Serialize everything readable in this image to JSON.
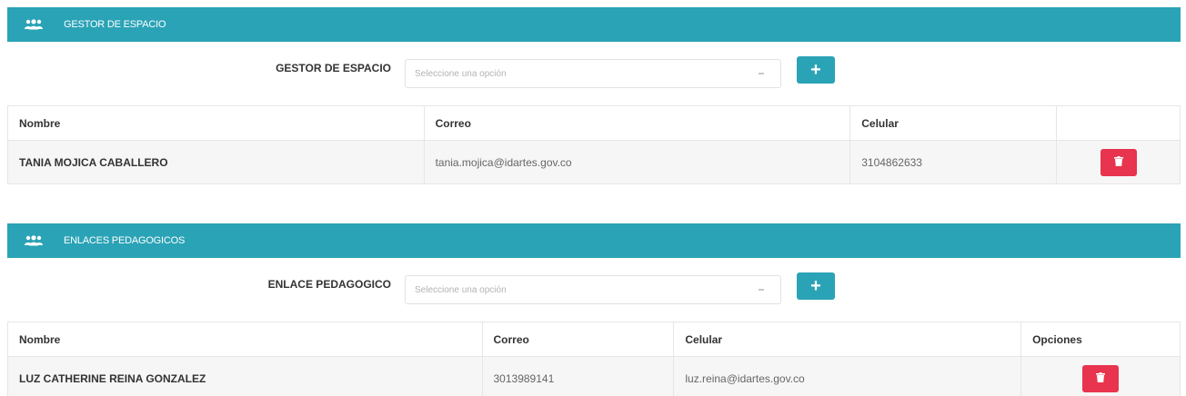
{
  "gestor": {
    "header_icon": "users-icon",
    "header_title": "GESTOR DE ESPACIO",
    "field_label": "GESTOR DE ESPACIO",
    "select_placeholder": "Seleccione una opción",
    "add_icon": "plus-icon",
    "table": {
      "columns": [
        "Nombre",
        "Correo",
        "Celular",
        ""
      ],
      "rows": [
        {
          "nombre": "TANIA MOJICA CABALLERO",
          "correo": "tania.mojica@idartes.gov.co",
          "celular": "3104862633",
          "delete_icon": "trash-icon"
        }
      ]
    }
  },
  "enlaces": {
    "header_icon": "users-icon",
    "header_title": "ENLACES PEDAGOGICOS",
    "field_label": "ENLACE PEDAGOGICO",
    "select_placeholder": "Seleccione una opción",
    "add_icon": "plus-icon",
    "table": {
      "columns": [
        "Nombre",
        "Correo",
        "Celular",
        "Opciones"
      ],
      "rows": [
        {
          "nombre": "LUZ CATHERINE REINA GONZALEZ",
          "correo": "3013989141",
          "celular": "luz.reina@idartes.gov.co",
          "delete_icon": "trash-icon"
        }
      ]
    }
  },
  "colors": {
    "header_bg": "#2aa3b6",
    "add_button": "#2aa3b6",
    "delete_button": "#e8344e"
  }
}
